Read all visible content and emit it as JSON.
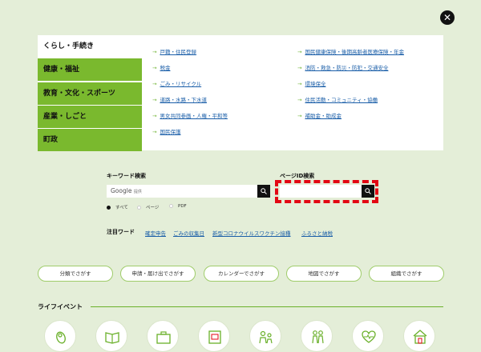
{
  "close": {
    "glyph": "✕"
  },
  "menu": {
    "categories": [
      {
        "label": "くらし・手続き"
      },
      {
        "label": "健康・福祉"
      },
      {
        "label": "教育・文化・スポーツ"
      },
      {
        "label": "産業・しごと"
      },
      {
        "label": "町政"
      }
    ],
    "links_left": [
      {
        "label": "戸籍・住民登録"
      },
      {
        "label": "税金"
      },
      {
        "label": "ごみ・リサイクル"
      },
      {
        "label": "道路・水路・下水道"
      },
      {
        "label": "男女共同参画・人権・平和等"
      },
      {
        "label": "国民保護"
      }
    ],
    "links_right": [
      {
        "label": "国民健康保険・後期高齢者医療保険・年金"
      },
      {
        "label": "消防・救急・防災・防犯・交通安全"
      },
      {
        "label": "環境保全"
      },
      {
        "label": "住民活動・コミュニティ・協働"
      },
      {
        "label": "補助金・助成金"
      }
    ],
    "arrow": "→"
  },
  "search": {
    "keyword_label": "キーワード検索",
    "keyword_placeholder": "Google",
    "keyword_placeholder_suffix": "提供",
    "pageid_label": "ページID検索",
    "radios": [
      {
        "label": "すべて",
        "checked": true
      },
      {
        "label": "ページ",
        "checked": false
      },
      {
        "label": "PDF",
        "checked": false
      }
    ]
  },
  "keywords": {
    "label": "注目ワード",
    "items": [
      {
        "label": "確定申告"
      },
      {
        "label": "ごみの収集日"
      },
      {
        "label": "新型コロナウイルスワクチン接種"
      },
      {
        "label": "ふるさと納税"
      }
    ]
  },
  "finders": [
    {
      "label": "分類でさがす"
    },
    {
      "label": "申請・届け出でさがす"
    },
    {
      "label": "カレンダーでさがす"
    },
    {
      "label": "地図でさがす"
    },
    {
      "label": "組織でさがす"
    }
  ],
  "life_events": {
    "title": "ライフイベント",
    "icons": [
      "baby-icon",
      "book-icon",
      "briefcase-icon",
      "certificate-icon",
      "family-icon",
      "elderly-icon",
      "heart-icon",
      "house-icon"
    ]
  },
  "colors": {
    "accent_green": "#7ab92e",
    "background": "#e4eed8",
    "highlight_red": "#e30613",
    "link_blue": "#1a5ea8"
  }
}
